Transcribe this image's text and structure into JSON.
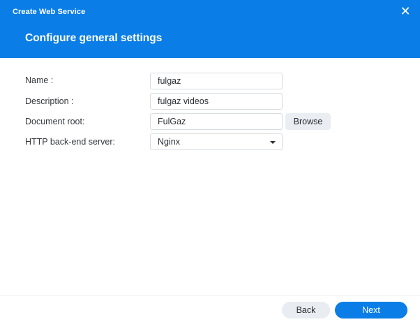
{
  "window": {
    "title": "Create Web Service",
    "close_icon": "close-icon"
  },
  "step": {
    "title": "Configure general settings"
  },
  "form": {
    "name": {
      "label": "Name :",
      "value": "fulgaz"
    },
    "description": {
      "label": "Description :",
      "value": "fulgaz videos"
    },
    "document_root": {
      "label": "Document root:",
      "value": "FulGaz",
      "browse_label": "Browse"
    },
    "backend": {
      "label": "HTTP back-end server:",
      "selected": "Nginx"
    }
  },
  "footer": {
    "back_label": "Back",
    "next_label": "Next"
  },
  "colors": {
    "accent": "#0a7ee6",
    "header_text": "#ffffff",
    "secondary_button": "#e9edf2"
  }
}
